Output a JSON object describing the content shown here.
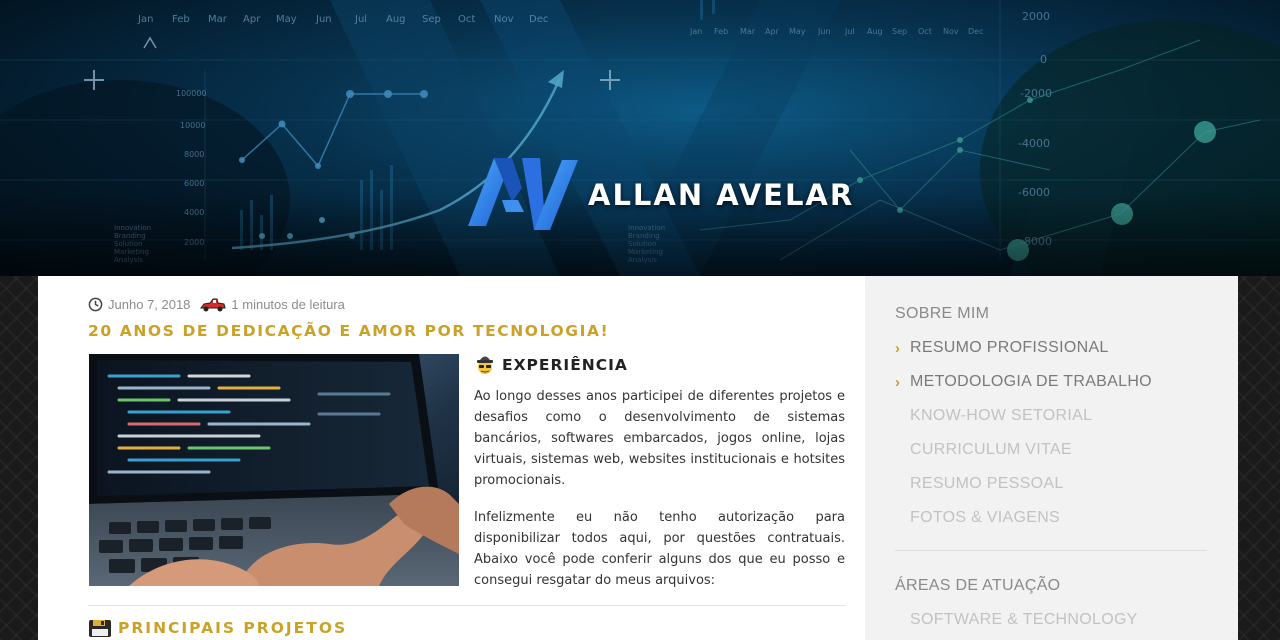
{
  "header": {
    "brand_name": "ALLAN AVELAR",
    "logo_icon": "av-logo-icon"
  },
  "post": {
    "date": "Junho 7, 2018",
    "read_time": "1 minutos de leitura",
    "title": "20 ANOS DE DEDICAÇÃO E AMOR POR TECNOLOGIA!",
    "image_icon": "laptop-code-photo",
    "experience": {
      "heading": "EXPERIÊNCIA",
      "icon": "spy-emoji-icon",
      "paragraph1": "Ao longo desses anos participei de diferentes projetos e desafios como o desenvolvimento de sistemas bancários, softwares embarcados, jogos online, lojas virtuais, sistemas web, websites institucionais e hotsites promocionais.",
      "paragraph2": "Infelizmente eu não tenho autorização para disponibilizar todos aqui, por questões contratuais. Abaixo você pode conferir alguns dos que eu posso e consegui resgatar do meus arquivos:"
    },
    "projects": {
      "heading": "PRINCIPAIS PROJETOS",
      "icon": "floppy-emoji-icon"
    }
  },
  "sidebar": {
    "section1": {
      "heading": "SOBRE MIM",
      "items": [
        {
          "label": "RESUMO PROFISSIONAL"
        },
        {
          "label": "METODOLOGIA DE TRABALHO"
        },
        {
          "label": "KNOW-HOW SETORIAL"
        },
        {
          "label": "CURRICULUM VITAE"
        },
        {
          "label": "RESUMO PESSOAL"
        },
        {
          "label": "FOTOS & VIAGENS"
        }
      ]
    },
    "section2": {
      "heading": "ÁREAS DE ATUAÇÃO",
      "items": [
        {
          "label": "SOFTWARE & TECHNOLOGY"
        }
      ]
    }
  },
  "colors": {
    "accent": "#c9a227",
    "sidebar_bg": "#f2f2f2",
    "header_blue": "#0d5a86"
  }
}
